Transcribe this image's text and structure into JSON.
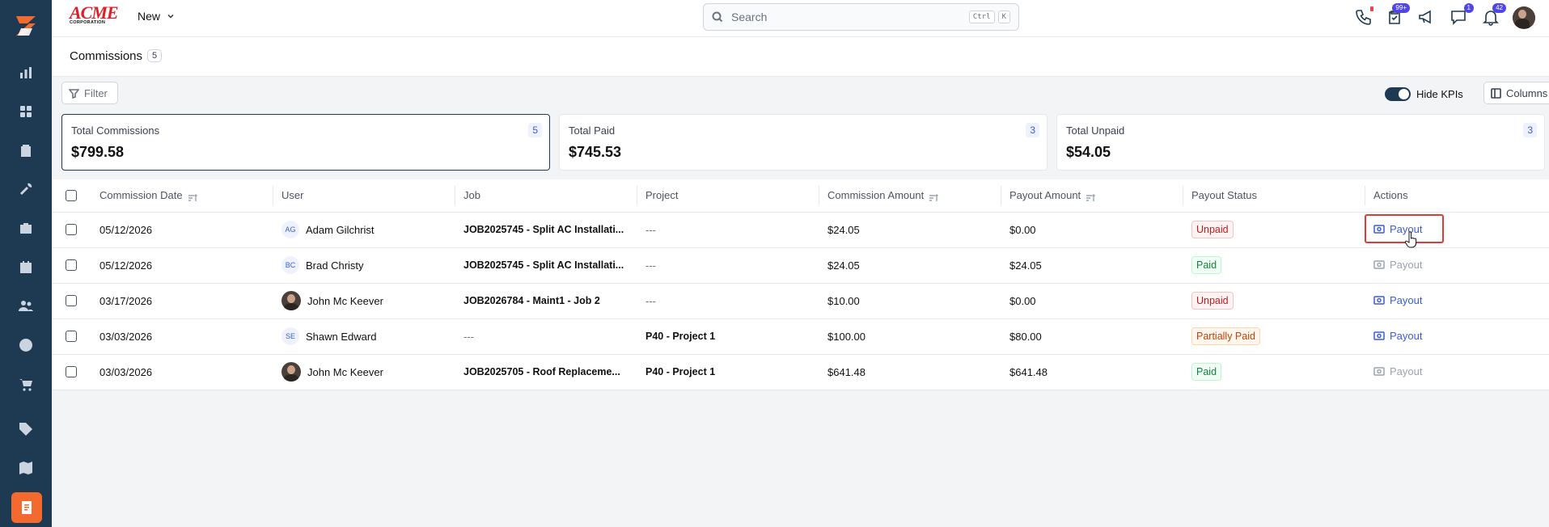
{
  "sidebar": {
    "items": [
      {
        "icon": "chart-bar-icon"
      },
      {
        "icon": "grid-icon"
      },
      {
        "icon": "clipboard-icon"
      },
      {
        "icon": "tools-icon"
      },
      {
        "icon": "briefcase-icon"
      },
      {
        "icon": "calendar-icon"
      },
      {
        "icon": "users-icon"
      },
      {
        "icon": "clock-icon"
      },
      {
        "icon": "cart-icon"
      },
      {
        "icon": "tag-icon"
      },
      {
        "icon": "map-icon"
      },
      {
        "icon": "invoice-icon"
      }
    ],
    "active_color": "#f26a2e",
    "bg_color": "#1e3a52"
  },
  "topbar": {
    "brand": "ACME",
    "brand_sub": "CORPORATION",
    "new_label": "New",
    "search_placeholder": "Search",
    "kbd_ctrl": "Ctrl",
    "kbd_k": "K",
    "badges": {
      "tasks": "99+",
      "messages": "1",
      "notifications": "42"
    }
  },
  "page": {
    "title": "Commissions",
    "count": "5"
  },
  "toolbar": {
    "filter_label": "Filter",
    "hide_kpis_label": "Hide KPIs",
    "hide_kpis_on": true,
    "columns_label": "Columns"
  },
  "kpis": [
    {
      "label": "Total Commissions",
      "value": "$799.58",
      "count": "5"
    },
    {
      "label": "Total Paid",
      "value": "$745.53",
      "count": "3"
    },
    {
      "label": "Total Unpaid",
      "value": "$54.05",
      "count": "3"
    }
  ],
  "table": {
    "headers": {
      "date": "Commission Date",
      "user": "User",
      "job": "Job",
      "project": "Project",
      "commission": "Commission Amount",
      "payout_amount": "Payout Amount",
      "status": "Payout Status",
      "actions": "Actions"
    },
    "rows": [
      {
        "date": "05/12/2026",
        "user": "Adam Gilchrist",
        "initials": "AG",
        "job": "JOB2025745 - Split AC Installati...",
        "project": "---",
        "commission": "$24.05",
        "payout": "$0.00",
        "status": "Unpaid",
        "action": "Payout"
      },
      {
        "date": "05/12/2026",
        "user": "Brad Christy",
        "initials": "BC",
        "job": "JOB2025745 - Split AC Installati...",
        "project": "---",
        "commission": "$24.05",
        "payout": "$24.05",
        "status": "Paid",
        "action": "Payout"
      },
      {
        "date": "03/17/2026",
        "user": "John Mc Keever",
        "initials": "",
        "job": "JOB2026784 - Maint1 - Job 2",
        "project": "---",
        "commission": "$10.00",
        "payout": "$0.00",
        "status": "Unpaid",
        "action": "Payout"
      },
      {
        "date": "03/03/2026",
        "user": "Shawn Edward",
        "initials": "SE",
        "job": "---",
        "project": "P40 - Project 1",
        "commission": "$100.00",
        "payout": "$80.00",
        "status": "Partially Paid",
        "action": "Payout"
      },
      {
        "date": "03/03/2026",
        "user": "John Mc Keever",
        "initials": "",
        "job": "JOB2025705 - Roof Replaceme...",
        "project": "P40 - Project 1",
        "commission": "$641.48",
        "payout": "$641.48",
        "status": "Paid",
        "action": "Payout"
      }
    ]
  }
}
